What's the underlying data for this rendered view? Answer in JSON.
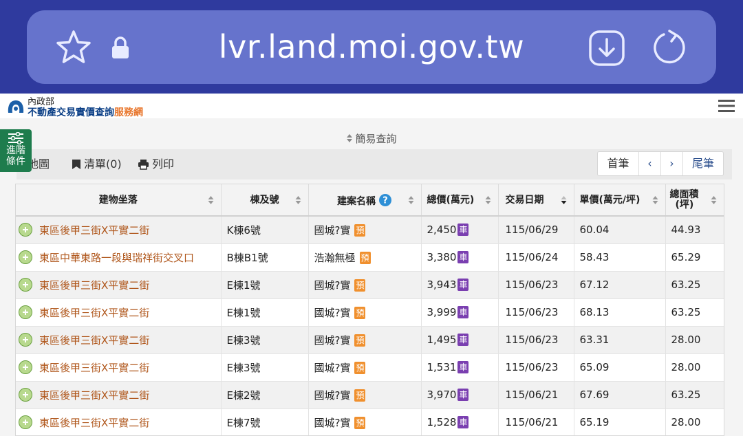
{
  "browser": {
    "url": "lvr.land.moi.gov.tw"
  },
  "header": {
    "ministry": "內政部",
    "site_name": "不動產交易實價查詢",
    "site_suffix": "服務網"
  },
  "search": {
    "toggle_label": "簡易查詢"
  },
  "toolbar": {
    "map_label": "地圖",
    "list_label": "清單(0)",
    "print_label": "列印"
  },
  "pager": {
    "first": "首筆",
    "prev": "‹",
    "next": "›",
    "last": "尾筆"
  },
  "advanced_button": {
    "line1": "進階",
    "line2": "條件"
  },
  "table": {
    "columns": {
      "address": "建物坐落",
      "unit": "棟及號",
      "project": "建案名稱",
      "price": "總價(萬元)",
      "date": "交易日期",
      "unit_price": "單價(萬元/坪)",
      "area_line1": "總面積",
      "area_line2": "(坪)"
    },
    "badges": {
      "car": "車",
      "presale": "預"
    },
    "rows": [
      {
        "address": "東區後甲三街X平實二街",
        "unit": "K棟6號",
        "project": "國城?實",
        "price": "2,450",
        "date": "115/06/29",
        "unit_price": "60.04",
        "area": "44.93"
      },
      {
        "address": "東區中華東路一段與瑞祥街交叉口",
        "unit": "B棟B1號",
        "project": "浩瀚無極",
        "price": "3,380",
        "date": "115/06/24",
        "unit_price": "58.43",
        "area": "65.29"
      },
      {
        "address": "東區後甲三街X平實二街",
        "unit": "E棟1號",
        "project": "國城?實",
        "price": "3,943",
        "date": "115/06/23",
        "unit_price": "67.12",
        "area": "63.25"
      },
      {
        "address": "東區後甲三街X平實二街",
        "unit": "E棟1號",
        "project": "國城?實",
        "price": "3,999",
        "date": "115/06/23",
        "unit_price": "68.13",
        "area": "63.25"
      },
      {
        "address": "東區後甲三街X平實二街",
        "unit": "E棟3號",
        "project": "國城?實",
        "price": "1,495",
        "date": "115/06/23",
        "unit_price": "63.31",
        "area": "28.00"
      },
      {
        "address": "東區後甲三街X平實二街",
        "unit": "E棟3號",
        "project": "國城?實",
        "price": "1,531",
        "date": "115/06/23",
        "unit_price": "65.09",
        "area": "28.00"
      },
      {
        "address": "東區後甲三街X平實二街",
        "unit": "E棟2號",
        "project": "國城?實",
        "price": "3,970",
        "date": "115/06/21",
        "unit_price": "67.69",
        "area": "63.25"
      },
      {
        "address": "東區後甲三街X平實二街",
        "unit": "E棟7號",
        "project": "國城?實",
        "price": "1,528",
        "date": "115/06/21",
        "unit_price": "65.19",
        "area": "28.00"
      }
    ]
  }
}
